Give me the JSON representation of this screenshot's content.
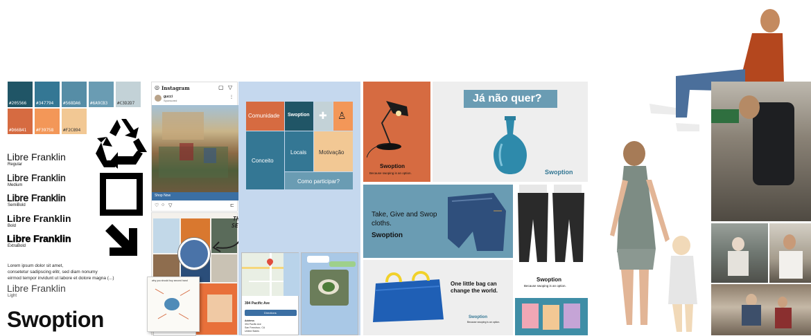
{
  "palette": {
    "swatches": [
      {
        "hex": "#205566",
        "label": "#205566"
      },
      {
        "hex": "#347794",
        "label": "#347794"
      },
      {
        "hex": "#568DA6",
        "label": "#568DA6"
      },
      {
        "hex": "#6A9CB3",
        "label": "#6A9CB3"
      },
      {
        "hex": "#C3D2D7",
        "label": "#C3D2D7"
      },
      {
        "hex": "#D66B41",
        "label": "#D66B41"
      },
      {
        "hex": "#F39758",
        "label": "#F39758"
      },
      {
        "hex": "#F2C894",
        "label": "#F2C894"
      }
    ]
  },
  "type_specimen": {
    "family": "Libre Franklin",
    "weights": [
      {
        "name": "Libre Franklin",
        "weight": "Regular"
      },
      {
        "name": "Libre Franklin",
        "weight": "Medium"
      },
      {
        "name": "Libre Franklin",
        "weight": "SemiBold"
      },
      {
        "name": "Libre Franklin",
        "weight": "Bold"
      },
      {
        "name": "Libre Franklin",
        "weight": "ExtraBold"
      }
    ],
    "lorem_1": "Lorem ipsum dolor sit amet,",
    "lorem_2": "consetetur sadipscing elitr, sed diam nonumy",
    "lorem_3": "eirmod tempor invidunt ut labore et dolore magna (...)",
    "light_name": "Libre Franklin",
    "light_weight": "Light",
    "wordmark": "Swoption"
  },
  "icons": [
    "recycle-icon",
    "square-outline-icon",
    "arrow-down-right-icon"
  ],
  "instagram": {
    "app": "Instagram",
    "account": "gucci",
    "sponsored": "Sponsored",
    "cta": "Shop Now"
  },
  "annotation": {
    "line1": "THIS IS",
    "line2": "SECOND HAND"
  },
  "mindmap": {
    "title": "why you should buy second hand"
  },
  "tilemap": {
    "comunidade": "Comunidade",
    "swoption": "Swoption",
    "conceito": "Conceito",
    "locais": "Locais",
    "motivacao": "Motivação",
    "como": "Como participar?"
  },
  "map_card": {
    "address": "394 Pacific Ave",
    "btn": "Directions",
    "addr_label": "Address",
    "addr1": "394 Pacific Ave",
    "addr2": "San Francisco, CA",
    "addr3": "United States"
  },
  "ads": {
    "swoption": "Swoption",
    "tagline": "Because swoping is an option.",
    "ja_nao_quer": "Já não quer?",
    "take_give_1": "Take, Give and Swop",
    "take_give_2": "cloths.",
    "little_bag_1": "One little bag can",
    "little_bag_2": "change the world."
  },
  "colors": {
    "orange": "#D66B41",
    "blue_dark": "#205566",
    "blue_mid": "#347794",
    "blue_light": "#6A9CB3",
    "peach": "#F2C894",
    "light_grey": "#EEEEEE",
    "pale_blue": "#C5D8EE"
  }
}
